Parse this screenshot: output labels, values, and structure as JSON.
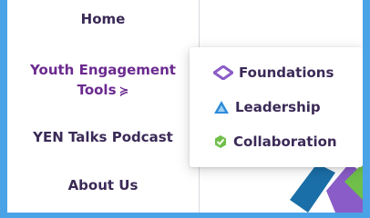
{
  "nav": {
    "home": "Home",
    "youth_tools_line1": "Youth Engagement",
    "youth_tools_line2": "Tools",
    "youth_tools_chevron": "≽",
    "podcast": "YEN Talks Podcast",
    "about": "About Us"
  },
  "dropdown": {
    "items": [
      {
        "label": "Foundations",
        "icon": "diamond-icon",
        "color": "#8a5cc7"
      },
      {
        "label": "Leadership",
        "icon": "triangle-icon",
        "color": "#2f8bd8"
      },
      {
        "label": "Collaboration",
        "icon": "hexagon-check-icon",
        "color": "#6fbf4a"
      }
    ]
  },
  "colors": {
    "frame_border": "#4aa3e6",
    "nav_text": "#3b2a57",
    "nav_active": "#6b2a8f"
  }
}
